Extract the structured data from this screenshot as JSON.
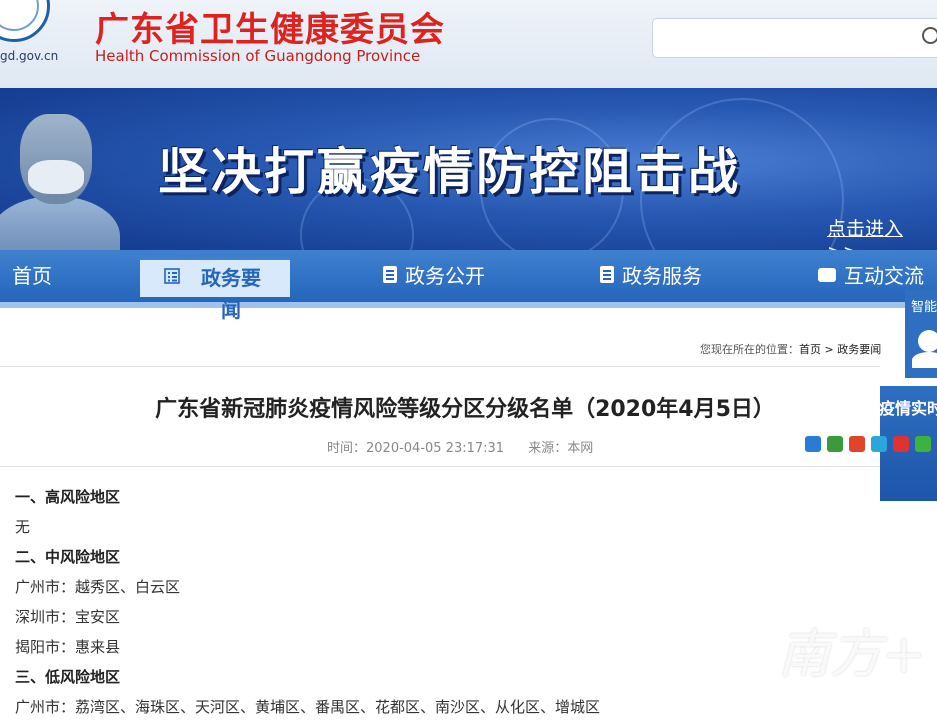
{
  "header": {
    "domain": "gd.gov.cn",
    "site_name_cn": "广东省卫生健康委员会",
    "site_name_en": "Health Commission of Guangdong Province",
    "search_placeholder": ""
  },
  "banner": {
    "title": "坚决打赢疫情防控阻击战",
    "enter_link": "点击进入 >>"
  },
  "nav": {
    "home": "首页",
    "news": "政务要闻",
    "open_gov": "政务公开",
    "services": "政务服务",
    "interaction": "互动交流"
  },
  "side": {
    "smart": "智能",
    "covid_realtime": "疫情实时"
  },
  "breadcrumb": {
    "label": "您现在所在的位置：",
    "home": "首页",
    "sep": ">",
    "section": "政务要闻"
  },
  "article": {
    "title": "广东省新冠肺炎疫情风险等级分区分级名单（2020年4月5日）",
    "time_label": "时间：2020-04-05 23:17:31",
    "source_label": "来源：本网",
    "lines": [
      {
        "text": "一、高风险地区",
        "heading": true
      },
      {
        "text": "无",
        "heading": false
      },
      {
        "text": "二、中风险地区",
        "heading": true
      },
      {
        "text": "广州市：越秀区、白云区",
        "heading": false
      },
      {
        "text": "深圳市：宝安区",
        "heading": false
      },
      {
        "text": "揭阳市：惠来县",
        "heading": false
      },
      {
        "text": "三、低风险地区",
        "heading": true
      },
      {
        "text": "广州市：荔湾区、海珠区、天河区、黄埔区、番禺区、花都区、南沙区、从化区、增城区",
        "heading": false
      }
    ]
  },
  "colors": {
    "brand_red": "#e0221f",
    "nav_blue": "#2566bb",
    "banner_blue": "#2657b0"
  }
}
